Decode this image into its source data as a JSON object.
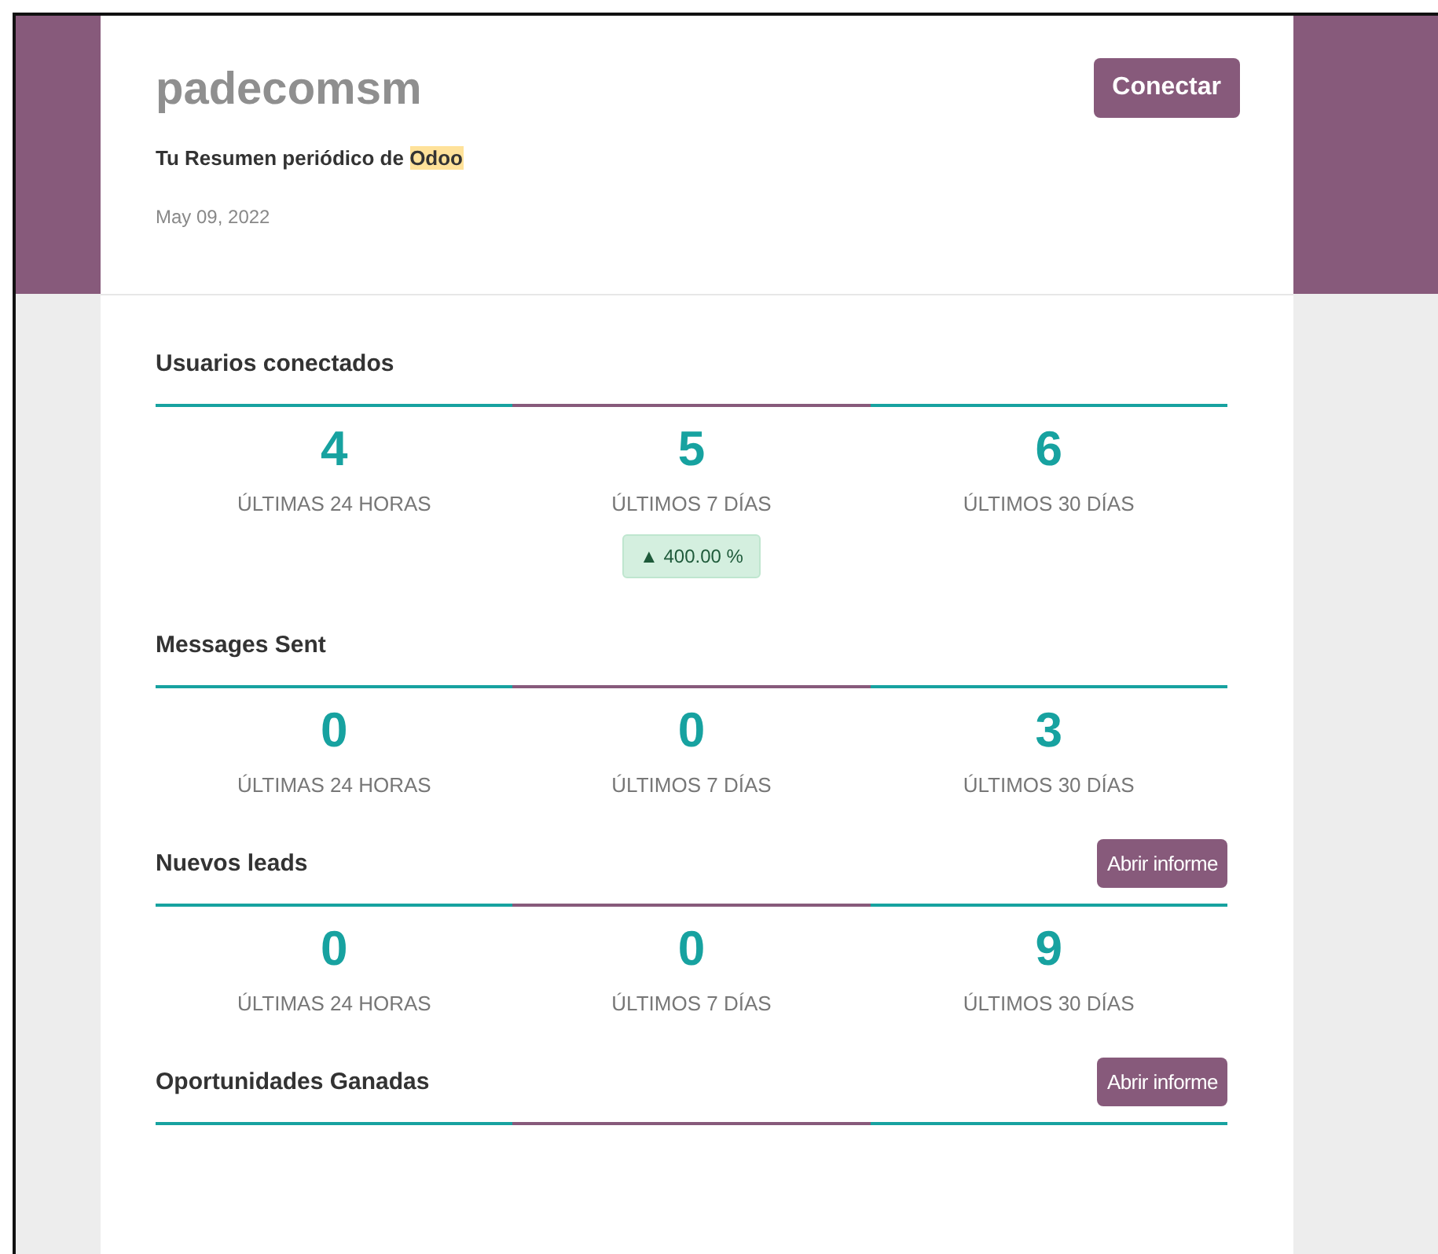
{
  "header": {
    "company": "padecomsm",
    "connect_button": "Conectar",
    "subtitle": {
      "text": "Tu Resumen periódico de ",
      "highlight": "Odoo"
    },
    "date": "May 09, 2022"
  },
  "sections": [
    {
      "title": "Usuarios conectados",
      "kpis": [
        {
          "value": "4",
          "label": "ÚLTIMAS 24 HORAS"
        },
        {
          "value": "5",
          "label": "ÚLTIMOS 7 DÍAS",
          "badge": "▲ 400.00 %"
        },
        {
          "value": "6",
          "label": "ÚLTIMOS 30 DÍAS"
        }
      ]
    },
    {
      "title": "Messages Sent",
      "kpis": [
        {
          "value": "0",
          "label": "ÚLTIMAS 24 HORAS"
        },
        {
          "value": "0",
          "label": "ÚLTIMOS 7 DÍAS"
        },
        {
          "value": "3",
          "label": "ÚLTIMOS 30 DÍAS"
        }
      ]
    },
    {
      "title": "Nuevos leads",
      "button": "Abrir informe",
      "kpis": [
        {
          "value": "0",
          "label": "ÚLTIMAS 24 HORAS"
        },
        {
          "value": "0",
          "label": "ÚLTIMOS 7 DÍAS"
        },
        {
          "value": "9",
          "label": "ÚLTIMOS 30 DÍAS"
        }
      ]
    },
    {
      "title": "Oportunidades Ganadas",
      "button": "Abrir informe"
    }
  ]
}
